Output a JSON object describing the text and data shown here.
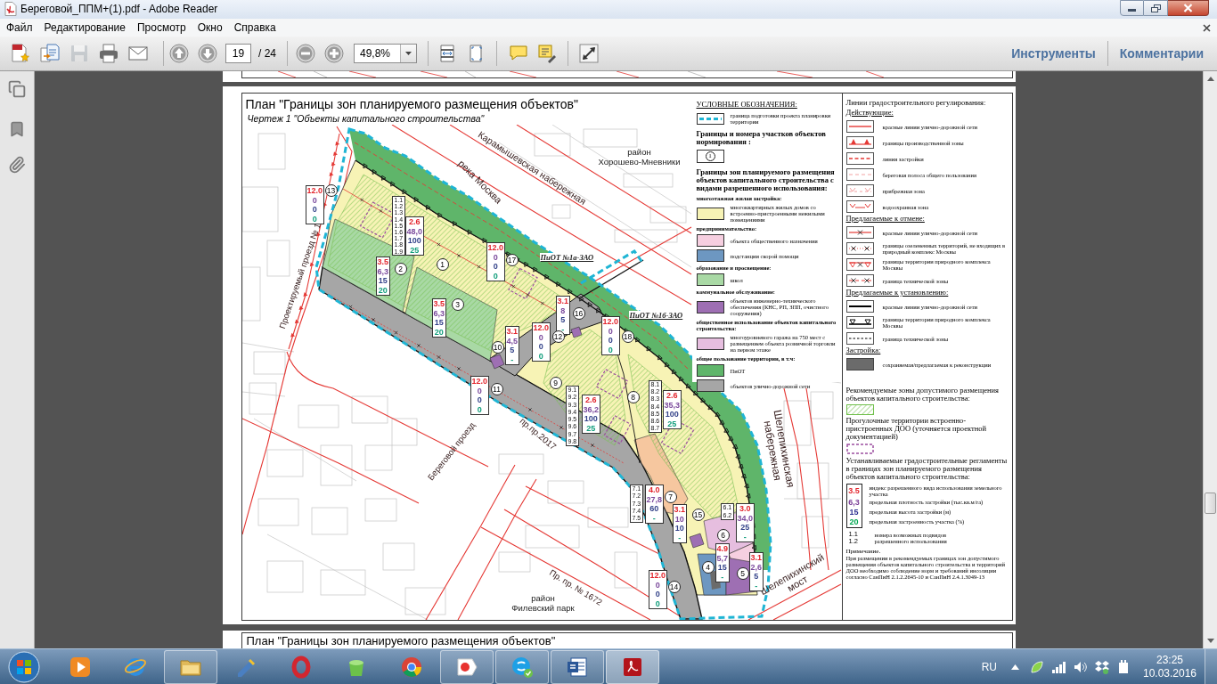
{
  "window": {
    "title": "Береговой_ППМ+(1).pdf - Adobe Reader"
  },
  "menu": [
    "Файл",
    "Редактирование",
    "Просмотр",
    "Окно",
    "Справка"
  ],
  "toolbar": {
    "file_buttons": [
      {
        "kind": "create",
        "disabled": false
      },
      {
        "kind": "combine",
        "disabled": false
      },
      {
        "kind": "save",
        "disabled": true
      },
      {
        "kind": "print",
        "disabled": false
      },
      {
        "kind": "email",
        "disabled": false
      }
    ],
    "page_number": "19",
    "page_total": "/ 24",
    "zoom": "49,8%",
    "panes": [
      "Инструменты",
      "Комментарии"
    ]
  },
  "document": {
    "title": "План \"Границы зон планируемого размещения объектов\"",
    "subtitle": "Чертеж 1 \"Объекты капитального строительства\"",
    "map": {
      "places": [
        [
          "район",
          "Хорошево-Мневники"
        ],
        [
          "район",
          "Филевский парк"
        ]
      ],
      "streets": [
        [
          "Карамышевская набережная"
        ],
        [
          "река Москва"
        ],
        [
          "Проектируемый проезд № 1"
        ],
        [
          "Береговой проезд"
        ],
        [
          "пр.пр.2017"
        ],
        [
          "Шелепихинская",
          "набережная"
        ],
        [
          "Шелепихинский",
          "мост"
        ],
        [
          "Пр. пр. № 1672"
        ]
      ],
      "zones": [
        "ПиОТ №1а-ЗАО",
        "ПиОТ №1б-ЗАО"
      ],
      "parcels": [
        "13",
        "2",
        "1",
        "17",
        "3",
        "16",
        "10",
        "12",
        "18",
        "11",
        "9",
        "8",
        "7",
        "15",
        "6",
        "4",
        "5",
        "14"
      ],
      "regulations": [
        [
          "12.0",
          "0",
          "0",
          "0"
        ],
        [
          "2.6",
          "48,0",
          "100",
          "25"
        ],
        [
          "12.0",
          "0",
          "0",
          "0"
        ],
        [
          "3.5",
          "6,3",
          "15",
          "20"
        ],
        [
          "3.5",
          "6,3",
          "15",
          "20"
        ],
        [
          "3.1",
          "8",
          "5",
          "-"
        ],
        [
          "3.1",
          "4,5",
          "5",
          "-"
        ],
        [
          "12.0",
          "0",
          "0",
          "0"
        ],
        [
          "12.0",
          "0",
          "0",
          "0"
        ],
        [
          "12.0",
          "0",
          "0",
          "0"
        ],
        [
          "2.6",
          "36,2",
          "100",
          "25"
        ],
        [
          "2.6",
          "35,3",
          "100",
          "25"
        ],
        [
          "4.0",
          "27,8",
          "60",
          "-"
        ],
        [
          "3.1",
          "10",
          "10",
          "-"
        ],
        [
          "3.0",
          "34,0",
          "25",
          "-"
        ],
        [
          "4.9",
          "5,7",
          "15",
          "-"
        ],
        [
          "3.1",
          "2,6",
          "5",
          "-"
        ],
        [
          "12.0",
          "0",
          "0",
          "0"
        ]
      ],
      "subtypes": [
        [
          "1.1",
          "1.2",
          "1.3",
          "1.4",
          "1.5",
          "1.6",
          "1.7",
          "1.8",
          "1.9"
        ],
        [
          "9.1",
          "9.2",
          "9.3",
          "9.4",
          "9.5",
          "9.6",
          "9.7",
          "9.8"
        ],
        [
          "8.1",
          "8.2",
          "8.3",
          "8.4",
          "8.5",
          "8.6",
          "8.7"
        ],
        [
          "7.1",
          "7.2",
          "7.3",
          "7.4",
          "7.5"
        ],
        [
          "6.1",
          "6.2"
        ]
      ]
    },
    "legend": {
      "title": "УСЛОВНЫЕ ОБОЗНАЧЕНИЯ:",
      "entries": [
        {
          "kind": "boundary",
          "label": "граница подготовки проекта планировки территории"
        },
        {
          "kind": "heading",
          "label": "Границы и номера участков объектов нормирования :"
        },
        {
          "kind": "parcel",
          "number": "1"
        },
        {
          "kind": "heading",
          "label": "Границы зон планируемого размещения объектов капитального строительства с видами разрешенного использования:"
        },
        {
          "kind": "group",
          "label": "многоэтажная жилая застройка:"
        },
        {
          "kind": "fill",
          "color": "#f7f3b5",
          "label": "многоквартирных жилых домов со встроенно-пристроенными нежилыми помещениями"
        },
        {
          "kind": "group",
          "label": "предпринимательство:"
        },
        {
          "kind": "fill",
          "color": "#f6cfe0",
          "label": "объекта общественного назначения"
        },
        {
          "kind": "fill",
          "color": "#6d97c1",
          "label": "подстанции скорой помощи"
        },
        {
          "kind": "group",
          "label": "образование и просвещение:"
        },
        {
          "kind": "fill",
          "color": "#a9d9a5",
          "label": "школ"
        },
        {
          "kind": "group",
          "label": "коммунальное обслуживание:"
        },
        {
          "kind": "fill",
          "color": "#9e6fb3",
          "label": "объектов инженерно-технического обеспечения (КНС, РП, ЗПП, очистного сооружения)"
        },
        {
          "kind": "group",
          "label": "общественное использование объектов капитального строительства:"
        },
        {
          "kind": "fill",
          "color": "#e6bedf",
          "label": "многоуровневого гаража на 750 мест с размещением объекта розничной торговли на первом этаже"
        },
        {
          "kind": "group",
          "label": "общее пользование территории, в т.ч:"
        },
        {
          "kind": "fill",
          "color": "#5fb56a",
          "label": "ПиОТ"
        },
        {
          "kind": "fill",
          "color": "#a6a6a6",
          "label": "объектов улично-дорожной сети"
        }
      ]
    },
    "lines_legend": {
      "title": "Линии градостроительного регулирования:",
      "sections": [
        {
          "title": "Действующие:",
          "items": [
            {
              "kind": "red",
              "label": "красные линии улично-дорожной сети"
            },
            {
              "kind": "production",
              "label": "границы производственной зоны"
            },
            {
              "kind": "building",
              "label": "линия застройки"
            },
            {
              "kind": "shore",
              "label": "береговая полоса общего пользования"
            },
            {
              "kind": "coastal",
              "label": "прибрежная зона"
            },
            {
              "kind": "waterguard",
              "label": "водоохранная зона"
            }
          ]
        },
        {
          "title": "Предлагаемые к отмене:",
          "items": [
            {
              "kind": "redcross",
              "label": "красные линии улично-дорожной сети"
            },
            {
              "kind": "greencross",
              "label": "границы озелененных территорий, не входящих в природный комплекс Москвы"
            },
            {
              "kind": "naturecross",
              "label": "границы территории природного комплекса Москвы"
            },
            {
              "kind": "techcross",
              "label": "граница технической зоны"
            }
          ]
        },
        {
          "title": "Предлагаемые к установлению:",
          "items": [
            {
              "kind": "black",
              "label": "красные линии улично-дорожной сети"
            },
            {
              "kind": "nature",
              "label": "границы территории природного комплекса Москвы"
            },
            {
              "kind": "tech",
              "label": "граница технической зоны"
            }
          ]
        },
        {
          "title": "Застройка:",
          "items": [
            {
              "kind": "buildings",
              "label": "сохраняемая/предлагаемая к реконструкции"
            }
          ]
        }
      ]
    },
    "zones_legend": [
      {
        "kind": "hatch",
        "label": "Рекомендуемые зоны допустимого размещения объектов капитального строительства:"
      },
      {
        "kind": "walk",
        "label": "Прогулочные территории встроенно-пристроенных ДОО (уточняется проектной документацией)"
      }
    ],
    "regulations_legend": {
      "title": "Устанавливаемые градостроительные регламенты в границах зон планируемого размещения объектов капитального строительства:",
      "rows": [
        {
          "value": "3.5",
          "label": "индекс разрешенного вида использования земельного участка"
        },
        {
          "value": "6,3",
          "label": "предельная плотность застройки (тыс.кв.м/га)"
        },
        {
          "value": "15",
          "label": "предельная высота застройки (м)"
        },
        {
          "value": "20",
          "label": "предельная застроенность участка (%)"
        }
      ],
      "subtypes": [
        "1.1",
        "1.2"
      ],
      "subtypes_label": "номера возможных подвидов разрешенного использования"
    },
    "note": {
      "title": "Примечание.",
      "text": "При размещении в рекомендуемых границах зон допустимого размещения объектов капитального строительства и территорий ДОО необходимо соблюдение норм и требований инсоляции согласно СанПиН 2.1.2.2645-10 и СанПиН 2.4.1.3049-13"
    },
    "next_page_title": "План \"Границы зон планируемого размещения объектов\""
  },
  "taskbar": {
    "apps": [
      {
        "kind": "media",
        "running": false,
        "selected": false
      },
      {
        "kind": "ie",
        "running": false,
        "selected": false
      },
      {
        "kind": "explorer",
        "running": true,
        "selected": false
      },
      {
        "kind": "tool",
        "running": false,
        "selected": false
      },
      {
        "kind": "opera",
        "running": false,
        "selected": false
      },
      {
        "kind": "cleaner",
        "running": false,
        "selected": false
      },
      {
        "kind": "chrome",
        "running": false,
        "selected": false
      },
      {
        "kind": "yandex",
        "running": true,
        "selected": false
      },
      {
        "kind": "skype",
        "running": true,
        "selected": false
      },
      {
        "kind": "word",
        "running": true,
        "selected": false
      },
      {
        "kind": "reader",
        "running": true,
        "selected": true
      }
    ],
    "language": "RU",
    "time": "23:25",
    "date": "10.03.2016"
  }
}
